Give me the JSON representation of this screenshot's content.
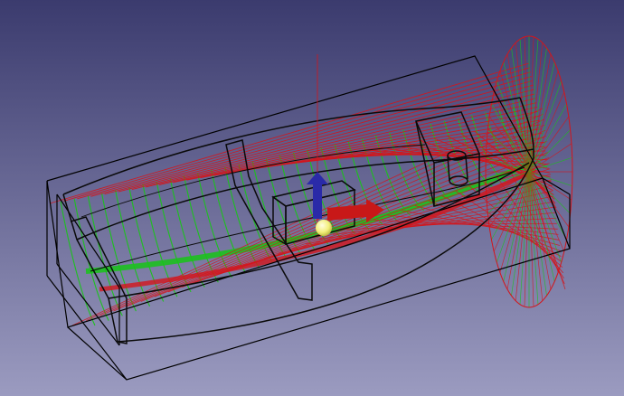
{
  "viewport": {
    "kind": "3d-cad-wireframe-viewport",
    "background_top": "#3b3b6e",
    "background_bottom": "#9b9bc0"
  },
  "scene": {
    "colors": {
      "bounding_box": "#000000",
      "hull_edges": "#0a0a0a",
      "section_lines_red": "#d4151b",
      "section_lines_green": "#18c418",
      "axis_z": "#2a2aa8",
      "axis_x": "#c81818",
      "center_marker": "#f2ef7a"
    },
    "icons": {
      "z_axis": "arrow-up-icon",
      "x_axis": "arrow-right-icon",
      "center": "sphere-icon"
    }
  }
}
